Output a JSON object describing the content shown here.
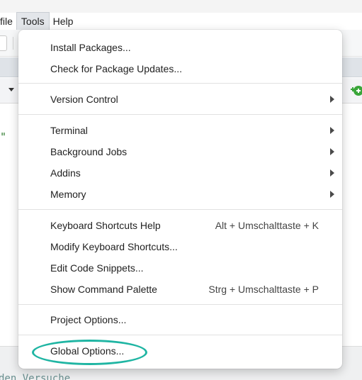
{
  "menubar": {
    "items": [
      "file",
      "Tools",
      "Help"
    ]
  },
  "editor": {
    "quote_char": "\""
  },
  "console": {
    "text": "den Versuche"
  },
  "tools_menu": {
    "install_packages": "Install Packages...",
    "check_updates": "Check for Package Updates...",
    "version_control": "Version Control",
    "terminal": "Terminal",
    "background_jobs": "Background Jobs",
    "addins": "Addins",
    "memory": "Memory",
    "keyboard_shortcuts_help": "Keyboard Shortcuts Help",
    "keyboard_shortcuts_help_shortcut": "Alt + Umschalttaste + K",
    "modify_keyboard_shortcuts": "Modify Keyboard Shortcuts...",
    "edit_code_snippets": "Edit Code Snippets...",
    "show_command_palette": "Show Command Palette",
    "show_command_palette_shortcut": "Strg + Umschalttaste + P",
    "project_options": "Project Options...",
    "global_options": "Global Options..."
  },
  "colors": {
    "highlight_ring": "#1fb5a3",
    "add_icon_green": "#3aa63a"
  },
  "icons": {
    "submenu": "chevron-right-icon",
    "add": "add-green-icon",
    "dropdown": "chevron-down-icon"
  }
}
